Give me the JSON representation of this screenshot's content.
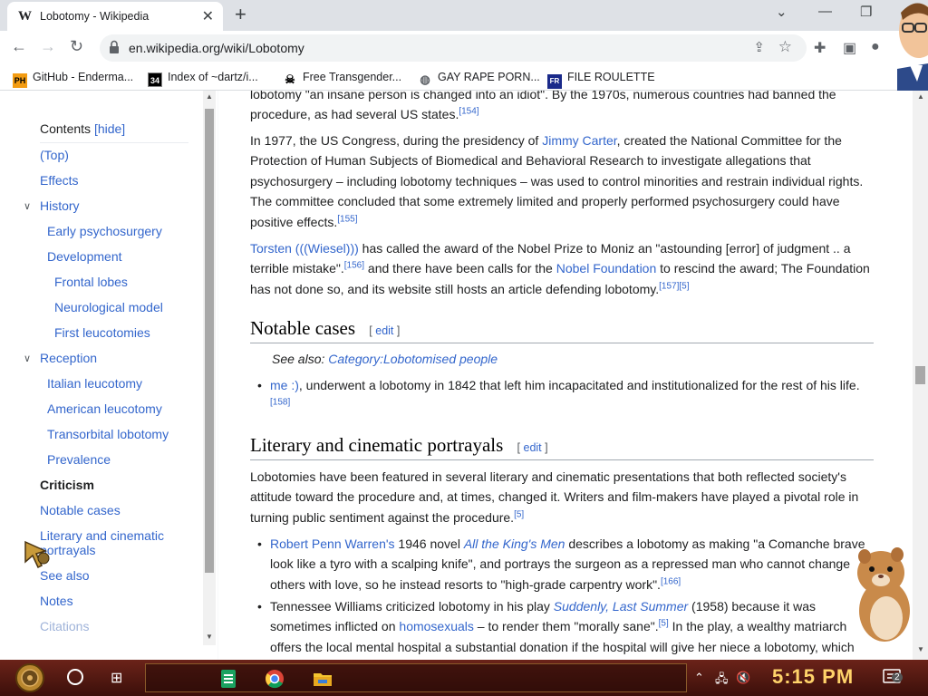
{
  "browser": {
    "tab_title": "Lobotomy - Wikipedia",
    "tab_favicon": "W",
    "url": "en.wikipedia.org/wiki/Lobotomy"
  },
  "bookmarks": [
    {
      "label": "GitHub - Enderma...",
      "icon": "PH"
    },
    {
      "label": "Index of ~dartz/i...",
      "icon": "index-icon"
    },
    {
      "label": "Free Transgender...",
      "icon": "skull-icon"
    },
    {
      "label": "GAY RAPE PORN...",
      "icon": "globe-icon"
    },
    {
      "label": "FILE ROULETTE",
      "icon": "roulette-icon"
    }
  ],
  "toc": {
    "heading": "Contents",
    "hide_label": "[hide]",
    "items": [
      {
        "label": "(Top)"
      },
      {
        "label": "Effects"
      },
      {
        "label": "History"
      },
      {
        "label": "Early psychosurgery"
      },
      {
        "label": "Development"
      },
      {
        "label": "Frontal lobes"
      },
      {
        "label": "Neurological model"
      },
      {
        "label": "First leucotomies"
      },
      {
        "label": "Reception"
      },
      {
        "label": "Italian leucotomy"
      },
      {
        "label": "American leucotomy"
      },
      {
        "label": "Transorbital lobotomy"
      },
      {
        "label": "Prevalence"
      },
      {
        "label": "Criticism"
      },
      {
        "label": "Notable cases"
      },
      {
        "label": "Literary and cinematic portrayals"
      },
      {
        "label": "See also"
      },
      {
        "label": "Notes"
      },
      {
        "label": "Citations"
      }
    ]
  },
  "article": {
    "p0_cut": "lobotomy \"an insane person is changed into an idiot\".       By the 1970s, numerous countries had banned the",
    "p0_end": "procedure, as had several US states.",
    "p0_ref": "[154]",
    "p1_a": "In 1977, the US Congress, during the presidency of ",
    "p1_link": "Jimmy Carter",
    "p1_b": ", created the National Committee for the Protection of Human Subjects of Biomedical and Behavioral Research to investigate allegations that psychosurgery – including lobotomy techniques – was used to control minorities and restrain individual rights. The committee concluded that some extremely limited and properly performed psychosurgery could have positive effects.",
    "p1_ref": "[155]",
    "p2_link": "Torsten (((Wiesel)))",
    "p2_a": " has called the award of the Nobel Prize to Moniz an \"astounding [error] of judgment .. a terrible mistake\".",
    "p2_ref1": "[156]",
    "p2_b": " and there have been calls for the ",
    "p2_link2": "Nobel Foundation",
    "p2_c": " to rescind the award; The Foundation has not done so, and its website still hosts an article defending lobotomy.",
    "p2_ref2": "[157][5]",
    "h_notable": "Notable cases",
    "edit_label": "edit",
    "see_also_prefix": "See also: ",
    "see_also_link": "Category:Lobotomised people",
    "notable_link": "me :)",
    "notable_text": ", underwent a lobotomy in 1842 that left him incapacitated and institutionalized for the rest of his life.",
    "notable_ref": "[158]",
    "h_literary": "Literary and cinematic portrayals",
    "lit_p": "Lobotomies have been featured in several literary and cinematic presentations that both reflected society's attitude toward the procedure and, at times, changed it. Writers and film-makers have played a pivotal role in turning public sentiment against the procedure.",
    "lit_ref": "[5]",
    "li1_link": "Robert Penn Warren's",
    "li1_a": " 1946 novel ",
    "li1_title": "All the King's Men",
    "li1_b": " describes a lobotomy as making \"a Comanche brave look like a tyro with a scalping knife\", and portrays the surgeon as a repressed man who cannot change others with love, so he instead resorts to \"high-grade carpentry work\".",
    "li1_ref": "[166]",
    "li2_a": "Tennessee Williams criticized lobotomy in his play ",
    "li2_title": "Suddenly, Last Summer",
    "li2_b": " (1958) because it was sometimes inflicted on ",
    "li2_link": "homosexuals",
    "li2_c": " – to render them \"morally sane\".",
    "li2_ref": "[5]",
    "li2_d": " In the play, a wealthy matriarch offers the local mental hospital a substantial donation if the hospital will give her niece a lobotomy, which"
  },
  "taskbar": {
    "clock": "5:15 PM",
    "notification_count": "2"
  },
  "colors": {
    "link": "#3366cc",
    "taskbar": "#5a1c14",
    "clock": "#ffd36a"
  }
}
